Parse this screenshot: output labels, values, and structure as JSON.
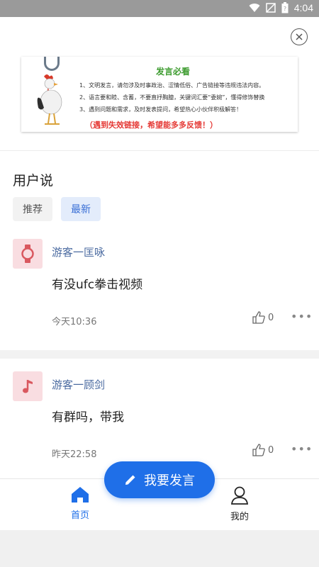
{
  "status_bar": {
    "time": "4:04"
  },
  "notice": {
    "title": "发言必看",
    "lines": [
      "1、文明发言，请勿涉及时事政治、涩情低俗、广告链接等违规违法内容。",
      "2、语言要和睦、含蓄，不要直抒胸臆，关键词汇要“委婉”，懂得修饰替换",
      "3、遇到问题和需求，及时发表提问，希望热心小伙伴积极解答！"
    ],
    "footer": "（遇到失效链接，希望能多多反馈！）"
  },
  "section": {
    "title": "用户说"
  },
  "tabs": [
    {
      "label": "推荐"
    },
    {
      "label": "最新"
    }
  ],
  "posts": [
    {
      "author": "游客一匡咏",
      "content": "有没ufc拳击视频",
      "time": "今天10:36",
      "likes": "0",
      "avatar_icon": "watch-icon"
    },
    {
      "author": "游客一顾剑",
      "content": "有群吗，带我",
      "time": "昨天22:58",
      "likes": "0",
      "avatar_icon": "music-note-icon"
    }
  ],
  "fab": {
    "label": "我要发言"
  },
  "nav": {
    "home_label": "首页",
    "mine_label": "我的"
  },
  "colors": {
    "accent": "#1f6fe8",
    "author": "#4a6aa0",
    "avatar_bg": "#f9dde1"
  }
}
